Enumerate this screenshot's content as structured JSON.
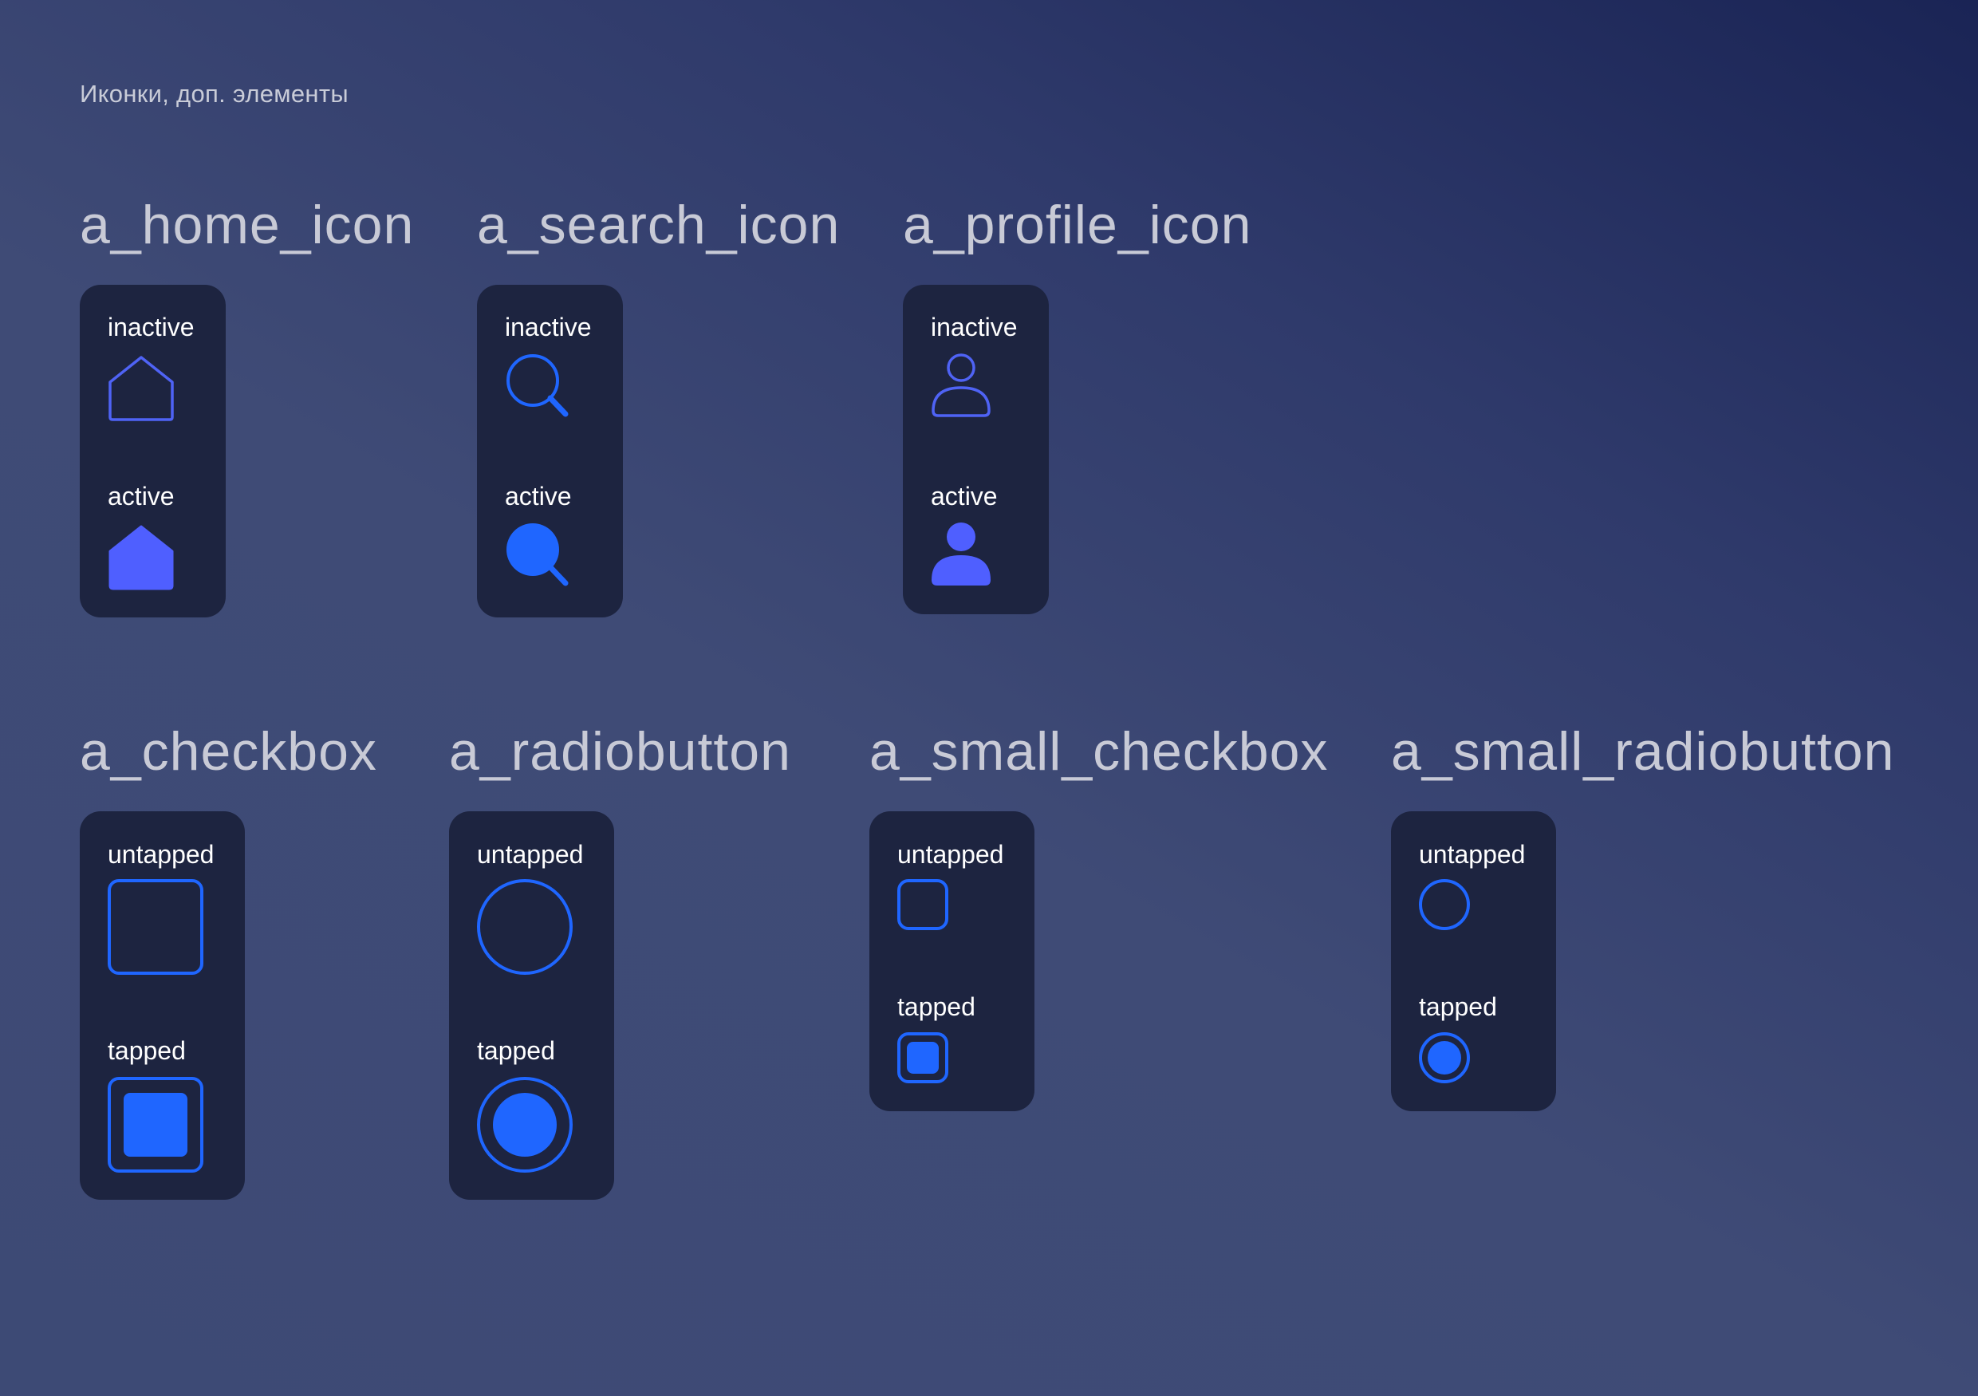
{
  "page": {
    "caption": "Иконки, доп. элементы"
  },
  "colors": {
    "card_bg": "#1d2440",
    "icon_stroke": "#4f63f5",
    "icon_fill": "#4f5fff",
    "control_blue": "#1f66ff",
    "label": "#ffffff",
    "title": "#c8cad6"
  },
  "components": {
    "home": {
      "title": "a_home_icon",
      "state1": "inactive",
      "state2": "active",
      "icon": "home-icon"
    },
    "search": {
      "title": "a_search_icon",
      "state1": "inactive",
      "state2": "active",
      "icon": "search-icon"
    },
    "profile": {
      "title": "a_profile_icon",
      "state1": "inactive",
      "state2": "active",
      "icon": "user-icon"
    },
    "checkbox": {
      "title": "a_checkbox",
      "state1": "untapped",
      "state2": "tapped"
    },
    "radiobutton": {
      "title": "a_radiobutton",
      "state1": "untapped",
      "state2": "tapped"
    },
    "small_checkbox": {
      "title": "a_small_checkbox",
      "state1": "untapped",
      "state2": "tapped"
    },
    "small_radiobutton": {
      "title": "a_small_radiobutton",
      "state1": "untapped",
      "state2": "tapped"
    }
  }
}
